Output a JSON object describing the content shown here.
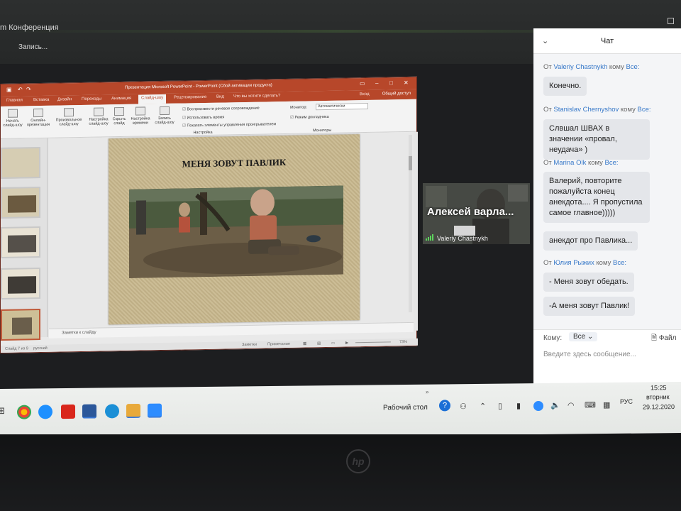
{
  "zoom": {
    "window_title": "m Конференция",
    "recording": "Запись..."
  },
  "powerpoint": {
    "title": "Презентация Microsoft PowerPoint - PowerPoint (Сбой активации продукта)",
    "signin": "Вход",
    "share": "Общий доступ",
    "tabs": [
      "Главная",
      "Вставка",
      "Дизайн",
      "Переходы",
      "Анимация",
      "Слайд-шоу",
      "Рецензирование",
      "Вид",
      "Что вы хотите сделать?"
    ],
    "active_tab": "Слайд-шоу",
    "ribbon": {
      "btn1": "Начать слайд-шоу",
      "btn2": "Онлайн-презентация",
      "btn3": "Произвольное слайд-шоу",
      "btn4": "Настройка слайд-шоу",
      "btn5": "Скрыть слайд",
      "btn6": "Настройка времени",
      "btn7": "Запись слайд-шоу",
      "chk1": "Воспроизвести речевое сопровождение",
      "chk2": "Использовать время",
      "chk3": "Показать элементы управления проигрывателем",
      "group_setup": "Настройка",
      "monitor_label": "Монитор:",
      "monitor_value": "Автоматически",
      "chk4": "Режим докладчика",
      "group_monitors": "Мониторы"
    },
    "slide": {
      "title": "МЕНЯ ЗОВУТ ПАВЛИК"
    },
    "notes": "Заметки к слайду",
    "status": {
      "slide": "Слайд 7 из 9",
      "language": "русский",
      "notes_btn": "Заметки",
      "comments_btn": "Примечания",
      "zoom": "73%"
    }
  },
  "video": {
    "display_name": "Алексей варла...",
    "participant": "Valeriy Chastnykh"
  },
  "chat": {
    "title": "Чат",
    "messages": [
      {
        "from_prefix": "От",
        "from": "Valeriy Chastnykh",
        "to_prefix": "кому",
        "to": "Все:",
        "texts": [
          "Конечно."
        ]
      },
      {
        "from_prefix": "От",
        "from": "Stanislav Chernyshov",
        "to_prefix": "кому",
        "to": "Все:",
        "texts": [
          "Слвшал ШВАХ в значении «провал, неудача» )"
        ]
      },
      {
        "from_prefix": "От",
        "from": "Marina Olk",
        "to_prefix": "кому",
        "to": "Все:",
        "texts": [
          "Валерий, повторите пожалуйста конец анекдота.... Я пропустила самое главное)))))",
          "анекдот про Павлика..."
        ]
      },
      {
        "from_prefix": "От",
        "from": "Юлия Рыжих",
        "to_prefix": "кому",
        "to": "Все:",
        "texts": [
          "- Меня зовут обедать.",
          "-А меня зовут Павлик!"
        ]
      }
    ],
    "to_label": "Кому:",
    "to_value": "Все",
    "file_label": "Файл",
    "input_placeholder": "Введите здесь сообщение..."
  },
  "taskbar": {
    "desktop_label": "Рабочий стол",
    "language": "РУС",
    "time": "15:25",
    "day": "вторник",
    "date": "29.12.2020",
    "more": "»"
  },
  "colors": {
    "ppt_accent": "#b7472a",
    "chat_sender": "#3577c8",
    "zoom_dark": "#1d1e20"
  }
}
